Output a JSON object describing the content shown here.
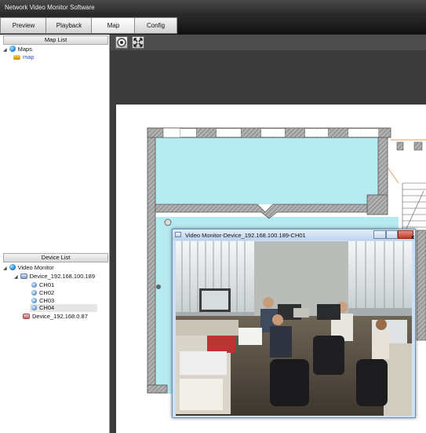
{
  "app": {
    "title": "Network Video Monitor Software"
  },
  "menu": {
    "items": [
      {
        "label": "Preview"
      },
      {
        "label": "Playback"
      },
      {
        "label": "Map"
      },
      {
        "label": "Config"
      }
    ]
  },
  "map_list": {
    "header": "Map List",
    "tree": [
      {
        "label": "Maps",
        "icon": "globe-icon",
        "expanded": true
      },
      {
        "label": "map",
        "icon": "map-icon"
      }
    ]
  },
  "device_list": {
    "header": "Device List",
    "tree": [
      {
        "label": "Video Monitor",
        "icon": "globe-icon",
        "expanded": true
      },
      {
        "label": "Device_192.168.100.189",
        "icon": "device-icon",
        "expanded": true
      },
      {
        "label": "CH01",
        "icon": "camera-icon"
      },
      {
        "label": "CH02",
        "icon": "camera-icon"
      },
      {
        "label": "CH03",
        "icon": "camera-icon"
      },
      {
        "label": "CH04",
        "icon": "camera-icon",
        "selected": true
      },
      {
        "label": "Device_192.168.0.87",
        "icon": "device-offline-icon"
      }
    ]
  },
  "map_toolbar": {
    "buttons": [
      {
        "icon": "zoom-in-icon"
      },
      {
        "icon": "fit-screen-icon"
      }
    ]
  },
  "video_window": {
    "title": "Video Monitor-Device_192.168.100.189-CH01",
    "buttons": [
      {
        "icon": "minimize-icon",
        "glyph": "–"
      },
      {
        "icon": "maximize-icon",
        "glyph": "□"
      },
      {
        "icon": "close-icon",
        "glyph": "x"
      }
    ]
  },
  "colors": {
    "room_fill": "#b6eaf1",
    "wall_hatch": "#8b8b8b",
    "window_titlebar": "#bcd3ee",
    "close_button": "#c23b26",
    "link_blue": "#2a4fd0"
  }
}
